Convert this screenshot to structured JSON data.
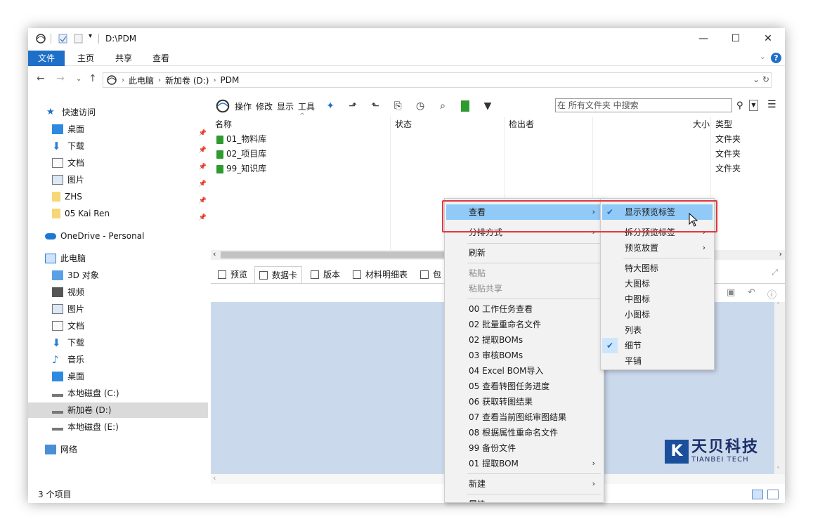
{
  "window": {
    "title": "D:\\PDM",
    "controls": {
      "minimize": "—",
      "maximize": "☐",
      "close": "✕"
    }
  },
  "ribbon": {
    "tabs": [
      "文件",
      "主页",
      "共享",
      "查看"
    ],
    "help": "?"
  },
  "address": {
    "crumbs": [
      "此电脑",
      "新加卷 (D:)",
      "PDM"
    ]
  },
  "sidebar": {
    "quick_access": "快速访问",
    "quick_items": [
      "桌面",
      "下载",
      "文档",
      "图片",
      "ZHS",
      "05 Kai Ren"
    ],
    "onedrive": "OneDrive - Personal",
    "this_pc": "此电脑",
    "pc_items": [
      "3D 对象",
      "视频",
      "图片",
      "文档",
      "下载",
      "音乐",
      "桌面",
      "本地磁盘 (C:)",
      "新加卷 (D:)",
      "本地磁盘 (E:)"
    ],
    "network": "网络"
  },
  "pdm_toolbar": {
    "labels": [
      "操作",
      "修改",
      "显示",
      "工具"
    ],
    "search_placeholder": "在 所有文件夹 中搜索"
  },
  "file_list": {
    "columns": [
      "名称",
      "状态",
      "检出者",
      "大小",
      "类型"
    ],
    "rows": [
      {
        "name": "01_物料库",
        "type": "文件夹"
      },
      {
        "name": "02_项目库",
        "type": "文件夹"
      },
      {
        "name": "99_知识库",
        "type": "文件夹"
      }
    ]
  },
  "bottom_tabs": [
    "预览",
    "数据卡",
    "版本",
    "材料明细表",
    "包"
  ],
  "logo": {
    "cn": "天贝科技",
    "en": "TIANBEI TECH"
  },
  "status": {
    "item_count": "3 个项目"
  },
  "context_menu": {
    "items": [
      {
        "label": "查看",
        "submenu": true,
        "highlight": true
      },
      {
        "label": "分排方式",
        "submenu": true
      },
      {
        "label": "刷新"
      },
      {
        "label": "粘贴",
        "disabled": true
      },
      {
        "label": "粘贴共享",
        "disabled": true
      },
      {
        "label": "00 工作任务查看"
      },
      {
        "label": "02 批量重命名文件"
      },
      {
        "label": "02 提取BOMs"
      },
      {
        "label": "03 审核BOMs"
      },
      {
        "label": "04 Excel BOM导入"
      },
      {
        "label": "05 查看转图任务进度"
      },
      {
        "label": "06 获取转图结果"
      },
      {
        "label": "07 查看当前图纸审图结果"
      },
      {
        "label": "08 根据属性重命名文件"
      },
      {
        "label": "99 备份文件"
      },
      {
        "label": "01 提取BOM",
        "submenu": true
      },
      {
        "label": "新建",
        "submenu": true
      },
      {
        "label": "属性"
      }
    ]
  },
  "view_submenu": {
    "items": [
      {
        "label": "显示预览标签",
        "checked": true,
        "highlight": true
      },
      {
        "label": "拆分预览标签",
        "submenu": true
      },
      {
        "label": "预览放置",
        "submenu": true
      },
      {
        "label": "特大图标"
      },
      {
        "label": "大图标"
      },
      {
        "label": "中图标"
      },
      {
        "label": "小图标"
      },
      {
        "label": "列表"
      },
      {
        "label": "细节",
        "checked": true
      },
      {
        "label": "平铺"
      }
    ]
  },
  "colors": {
    "accent": "#1e6fc8",
    "highlight": "#91c9f7",
    "panel": "#cbd9ec",
    "callout": "#e0393e"
  }
}
